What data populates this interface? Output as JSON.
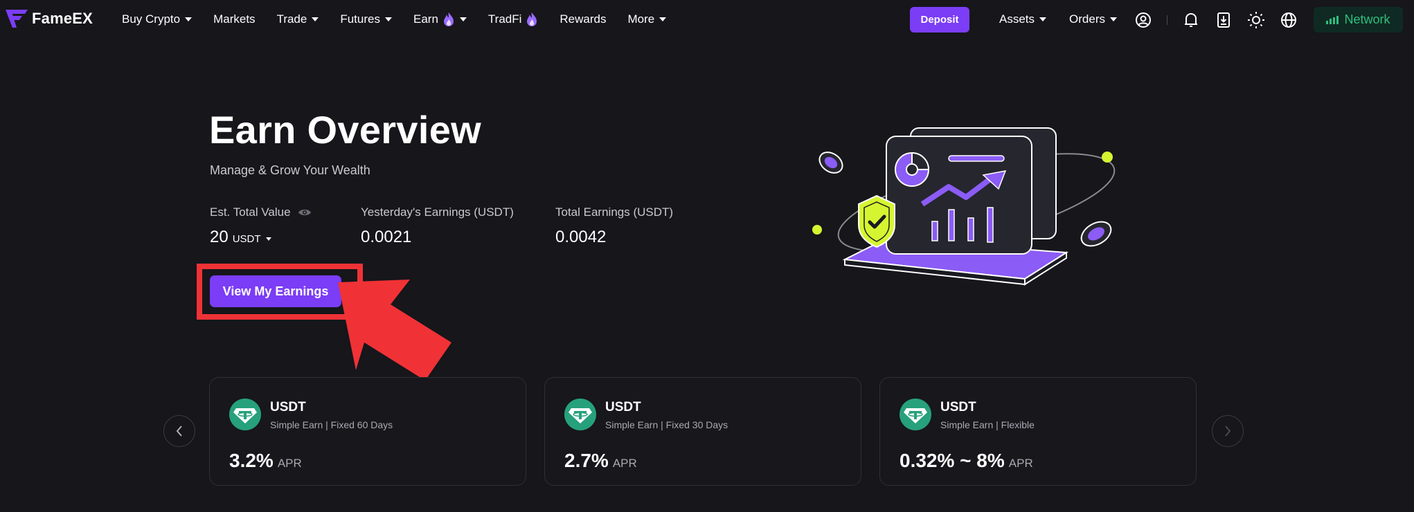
{
  "brand": {
    "name": "FameEX"
  },
  "nav": {
    "items": [
      {
        "label": "Buy Crypto",
        "dropdown": true
      },
      {
        "label": "Markets",
        "dropdown": false
      },
      {
        "label": "Trade",
        "dropdown": true
      },
      {
        "label": "Futures",
        "dropdown": true
      },
      {
        "label": "Earn",
        "dropdown": true,
        "icon": "fire-icon"
      },
      {
        "label": "TradFi",
        "dropdown": false,
        "icon": "fire-icon"
      },
      {
        "label": "Rewards",
        "dropdown": false
      },
      {
        "label": "More",
        "dropdown": true
      }
    ],
    "deposit_label": "Deposit",
    "assets_label": "Assets",
    "orders_label": "Orders",
    "icons": [
      "user-icon",
      "bell-icon",
      "download-icon",
      "sun-icon",
      "globe-icon"
    ],
    "network_label": "Network"
  },
  "hero": {
    "title": "Earn Overview",
    "subtitle": "Manage & Grow Your Wealth",
    "stats": {
      "total": {
        "label": "Est. Total Value",
        "value": "20",
        "unit": "USDT"
      },
      "yesterday": {
        "label": "Yesterday's Earnings (USDT)",
        "value": "0.0021"
      },
      "earnings": {
        "label": "Total Earnings (USDT)",
        "value": "0.0042"
      }
    },
    "cta_label": "View My Earnings"
  },
  "products": [
    {
      "coin": "USDT",
      "type": "Simple Earn | Fixed 60 Days",
      "rate": "3.2%",
      "rate_unit": "APR"
    },
    {
      "coin": "USDT",
      "type": "Simple Earn | Fixed 30 Days",
      "rate": "2.7%",
      "rate_unit": "APR"
    },
    {
      "coin": "USDT",
      "type": "Simple Earn | Flexible",
      "rate": "0.32% ~ 8%",
      "rate_unit": "APR"
    }
  ],
  "colors": {
    "background": "#16161b",
    "accent": "#7b3df5",
    "highlight_red": "#f03236",
    "network_green": "#2fbf7f",
    "tether_teal": "#26a17b",
    "lime": "#d6f531"
  }
}
